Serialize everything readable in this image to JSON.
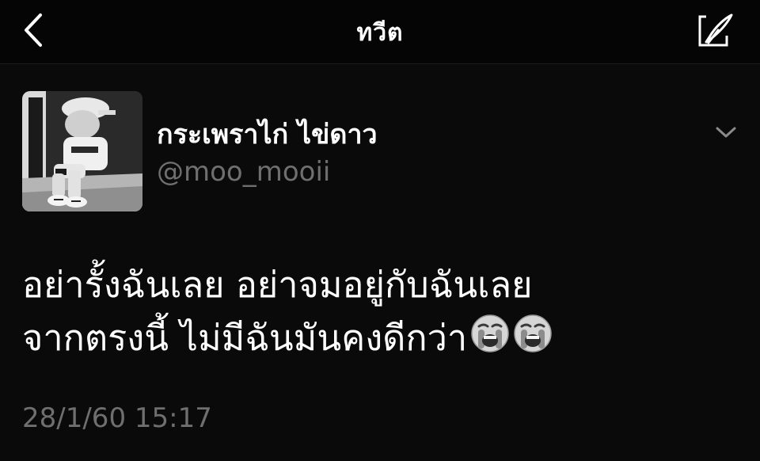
{
  "header": {
    "title": "ทวีต",
    "back_icon": "chevron-left-icon",
    "compose_icon": "compose-tweet-icon"
  },
  "tweet": {
    "display_name": "กระเพราไก่ ไข่ดาว",
    "handle": "@moo_mooii",
    "text_lines": [
      "อย่ารั้งฉันเลย อย่าจมอยู่กับฉันเลย",
      "จากตรงนี้ ไม่มีฉันมันคงดีกว่า"
    ],
    "emojis": [
      "loudly-crying-face-icon",
      "loudly-crying-face-icon"
    ],
    "timestamp": "28/1/60 15:17",
    "more_icon": "chevron-down-icon"
  },
  "colors": {
    "background": "#0a0a0a",
    "text_primary": "#ffffff",
    "text_secondary": "#6f6f6f"
  }
}
